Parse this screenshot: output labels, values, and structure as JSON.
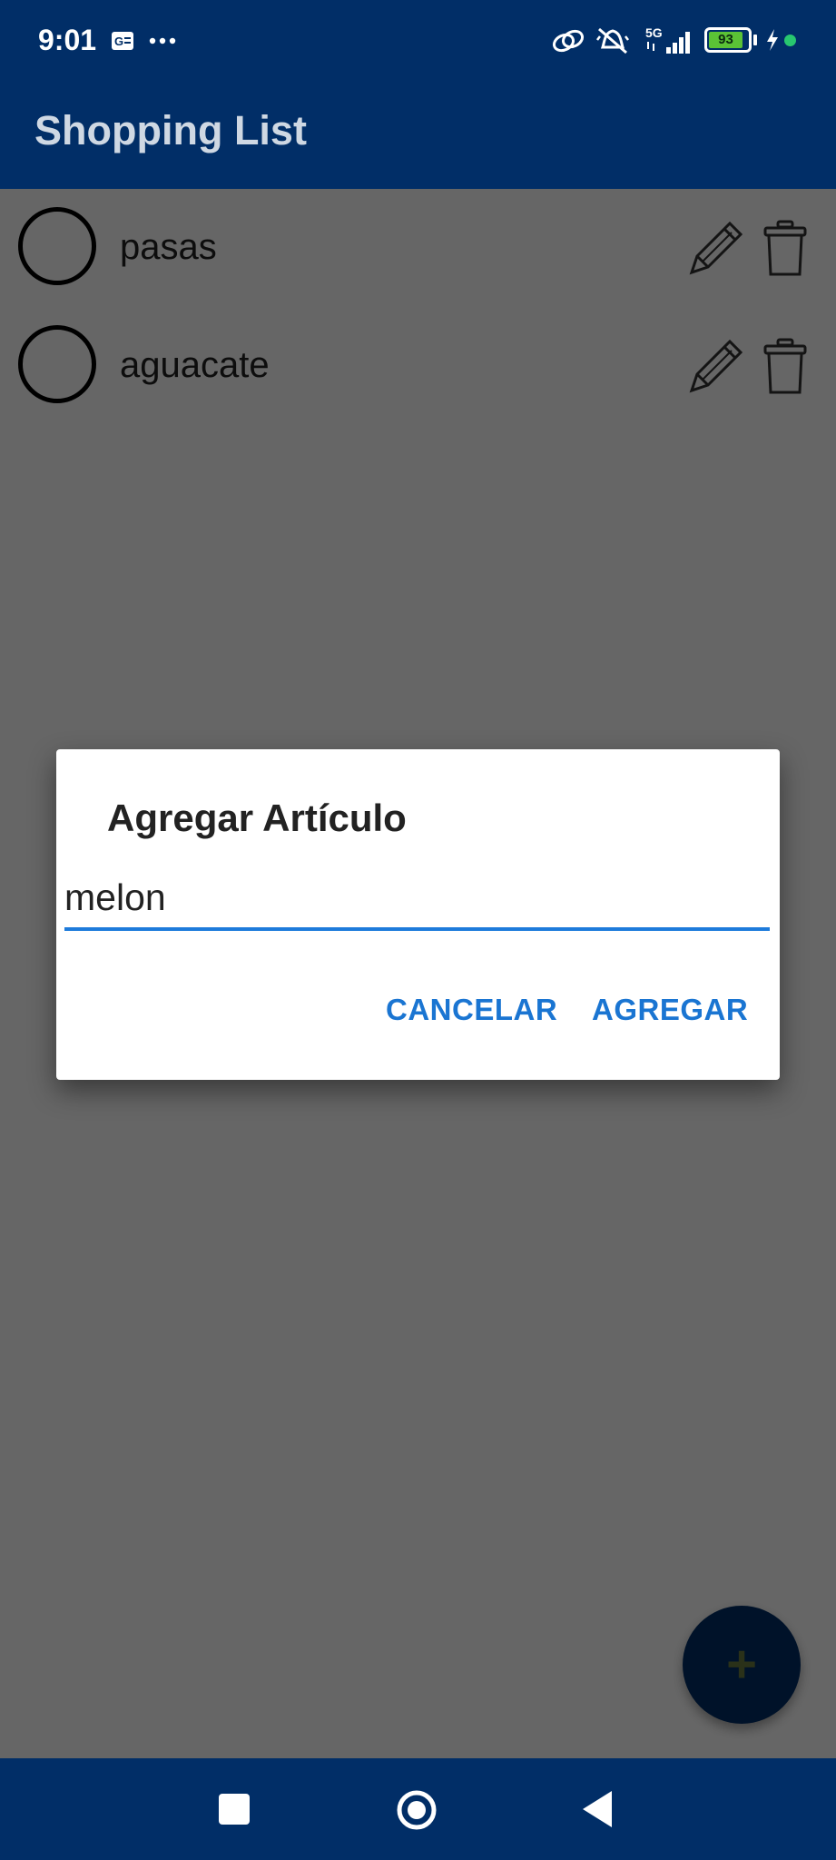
{
  "status_bar": {
    "time": "9:01",
    "network": "5G",
    "battery_level": "93",
    "icons": [
      "carrier-g-icon",
      "more-dots-icon",
      "link-icon",
      "mute-icon",
      "signal-icon",
      "battery-icon",
      "charging-icon",
      "camera-dot-icon"
    ]
  },
  "app_bar": {
    "title": "Shopping List"
  },
  "list": {
    "items": [
      {
        "label": "pasas"
      },
      {
        "label": "aguacate"
      }
    ]
  },
  "dialog": {
    "title": "Agregar Artículo",
    "input_value": "melon",
    "cancel_label": "CANCELAR",
    "add_label": "AGREGAR"
  },
  "fab": {
    "label": "+"
  },
  "colors": {
    "primary": "#012E67",
    "accent": "#1A75D2",
    "fab_icon": "#6A7B3F"
  }
}
